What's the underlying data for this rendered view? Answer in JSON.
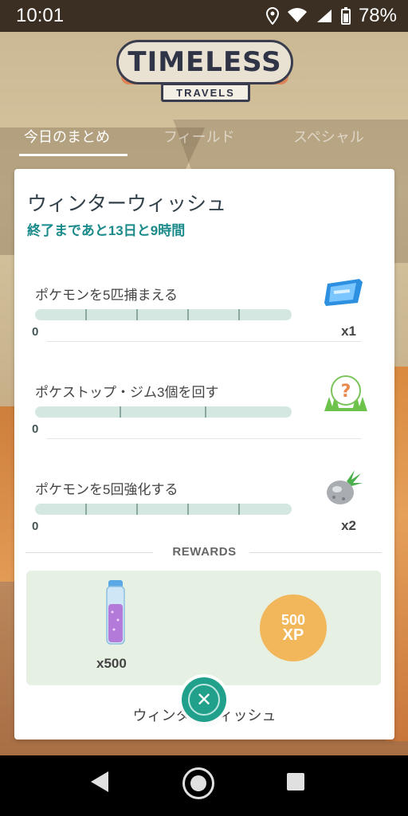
{
  "status_bar": {
    "time": "10:01",
    "battery": "78%",
    "icons": [
      "location-icon",
      "wifi-icon",
      "signal-icon",
      "battery-icon"
    ]
  },
  "logo": {
    "main": "TIMELESS",
    "sub": "TRAVELS"
  },
  "tabs": [
    {
      "label": "今日のまとめ",
      "active": true
    },
    {
      "label": "フィールド",
      "active": false
    },
    {
      "label": "スペシャル",
      "active": false
    }
  ],
  "card": {
    "title": "ウィンターウィッシュ",
    "subtitle": "終了まであと13日と9時間",
    "tasks": [
      {
        "label": "ポケモンを5匹捕まえる",
        "progress": "0",
        "reward_icon": "ticket-icon",
        "reward_count": "x1",
        "fraction": 0
      },
      {
        "label": "ポケストップ・ジム3個を回す",
        "progress": "0",
        "reward_icon": "mystery-encounter-icon",
        "reward_count": "",
        "fraction": 0
      },
      {
        "label": "ポケモンを5回強化する",
        "progress": "0",
        "reward_icon": "silver-pinap-berry-icon",
        "reward_count": "x2",
        "fraction": 0
      }
    ],
    "rewards_title": "REWARDS",
    "rewards": {
      "stardust_count": "x500",
      "xp_value": "500",
      "xp_label": "XP"
    },
    "footer_title": "ウィンターウィッシュ"
  },
  "colors": {
    "accent": "#1b8a8a",
    "close_button": "#21a18c",
    "xp": "#f1b75a",
    "reward_box": "#e6f1e3"
  }
}
